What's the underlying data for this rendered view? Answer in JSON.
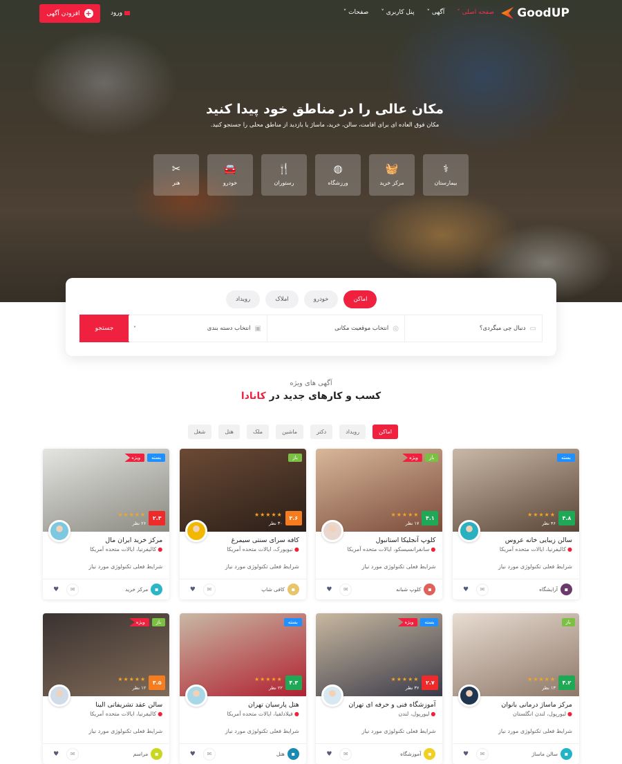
{
  "header": {
    "logo": "GoodUP",
    "menu": [
      {
        "label": "صفحه اصلی",
        "active": true
      },
      {
        "label": "آگهی"
      },
      {
        "label": "پنل کاربری"
      },
      {
        "label": "صفحات"
      }
    ],
    "login": "ورود",
    "add_listing": "افزودن آگهی"
  },
  "hero": {
    "title": "مکان عالی را در مناطق خود پیدا کنید",
    "subtitle": "مکان فوق العاده ای برای اقامت، سالن، خرید، ماساژ یا بازدید از مناطق محلی را جستجو کنید.",
    "categories": [
      {
        "label": "بیمارستان",
        "icon": "stethoscope-icon",
        "glyph": "⚕"
      },
      {
        "label": "مرکز خرید",
        "icon": "basket-icon",
        "glyph": "🧺"
      },
      {
        "label": "ورزشگاه",
        "icon": "basketball-icon",
        "glyph": "◍"
      },
      {
        "label": "رستوران",
        "icon": "utensils-icon",
        "glyph": "🍴"
      },
      {
        "label": "خودرو",
        "icon": "car-icon",
        "glyph": "🚘"
      },
      {
        "label": "هنر",
        "icon": "tools-icon",
        "glyph": "✂"
      }
    ]
  },
  "search": {
    "tabs": [
      {
        "label": "اماکن",
        "active": true
      },
      {
        "label": "خودرو"
      },
      {
        "label": "املاک"
      },
      {
        "label": "رویداد"
      }
    ],
    "keyword_placeholder": "دنبال چی میگردی؟",
    "location_placeholder": "انتخاب موقعیت مکانی",
    "category_placeholder": "انتخاب دسته بندی",
    "button": "جستجو"
  },
  "section": {
    "subtitle": "آگهی های ویژه",
    "title": "کسب و کارهای جدید در",
    "title_highlight": "کانادا",
    "filters": [
      {
        "label": "اماکن",
        "active": true
      },
      {
        "label": "رویداد"
      },
      {
        "label": "دکتر"
      },
      {
        "label": "ماشین"
      },
      {
        "label": "ملک"
      },
      {
        "label": "هتل"
      },
      {
        "label": "شغل"
      }
    ]
  },
  "colors": {
    "accent": "#f0213f",
    "open": "#7bc043",
    "closed": "#1e90ff",
    "rating_high": "#1fa855",
    "rating_mid": "#f57c1f",
    "rating_low": "#ee2a2a"
  },
  "cards": [
    {
      "title": "سالن زیبایی خانه عروس",
      "location": "کالیفرنیا، ایالات متحده آمریکا",
      "rating": "۴.۸",
      "rating_color": "#1fa855",
      "reviews": "۴۶ نظر",
      "stars": 5,
      "badges": [
        {
          "label": "بسته",
          "type": "closed"
        }
      ],
      "desc": "شرایط فعلی تکنولوژی مورد نیاز",
      "category": "آرایشگاه",
      "cat_color": "#6b3a6b",
      "img": [
        "#c9b8a8",
        "#5a4536"
      ],
      "avatar": "#2bb0c0"
    },
    {
      "title": "کلوپ آنجلیکا استانبول",
      "location": "سانفرانسیسکو، ایالات متحده آمریکا",
      "rating": "۴.۱",
      "rating_color": "#1fa855",
      "reviews": "۱۷ نظر",
      "stars": 5,
      "badges": [
        {
          "label": "باز",
          "type": "open"
        },
        {
          "label": "ویژه",
          "type": "feat"
        }
      ],
      "desc": "شرایط فعلی تکنولوژی مورد نیاز",
      "category": "کلوپ شبانه",
      "cat_color": "#e0605a",
      "img": [
        "#d8b79a",
        "#7a4b3a"
      ],
      "avatar": "#e8d8d0"
    },
    {
      "title": "کافه سرای سنتی سیمرغ",
      "location": "نیویورک، ایالات متحده آمریکا",
      "rating": "۳.۶",
      "rating_color": "#f57c1f",
      "reviews": "۳۰ نظر",
      "stars": 5,
      "badges": [
        {
          "label": "باز",
          "type": "open"
        }
      ],
      "desc": "شرایط فعلی تکنولوژی مورد نیاز",
      "category": "کافی شاپ",
      "cat_color": "#e8c46a",
      "img": [
        "#6b4a35",
        "#2a1e18"
      ],
      "avatar": "#f2b800"
    },
    {
      "title": "مرکز خرید ایران مال",
      "location": "کالیفرنیا، ایالات متحده آمریکا",
      "rating": "۲.۳",
      "rating_color": "#ee2a2a",
      "reviews": "۲۶ نظر",
      "stars": 5,
      "badges": [
        {
          "label": "بسته",
          "type": "closed"
        },
        {
          "label": "ویژه",
          "type": "feat"
        }
      ],
      "desc": "شرایط فعلی تکنولوژی مورد نیاز",
      "category": "مرکز خرید",
      "cat_color": "#2bb5c8",
      "img": [
        "#e4e4e2",
        "#8a8a80"
      ],
      "avatar": "#7bc8e0"
    },
    {
      "title": "مرکز ماساژ درمانی بانوان",
      "location": "لیورپول، لندن انگلستان",
      "rating": "۴.۲",
      "rating_color": "#1fa855",
      "reviews": "۱۳ نظر",
      "stars": 5,
      "badges": [
        {
          "label": "باز",
          "type": "open"
        }
      ],
      "desc": "شرایط فعلی تکنولوژی مورد نیاز",
      "category": "سالن ماساژ",
      "cat_color": "#22b3c6",
      "img": [
        "#e8dcd2",
        "#8e7868"
      ],
      "avatar": "#1f3550"
    },
    {
      "title": "آموزشگاه فنی و حرفه ای تهران",
      "location": "لیورپول، لندن",
      "rating": "۲.۷",
      "rating_color": "#ee2a2a",
      "reviews": "۳۶ نظر",
      "stars": 5,
      "badges": [
        {
          "label": "بسته",
          "type": "closed"
        },
        {
          "label": "ویژه",
          "type": "feat"
        }
      ],
      "desc": "شرایط فعلی تکنولوژی مورد نیاز",
      "category": "آموزشگاه",
      "cat_color": "#f0d020",
      "img": [
        "#c8b8a0",
        "#3a3a48"
      ],
      "avatar": "#d8e8f0"
    },
    {
      "title": "هتل پارسیان تهران",
      "location": "فیلادلفیا، ایالات متحده آمریکا",
      "rating": "۴.۳",
      "rating_color": "#1fa855",
      "reviews": "۲۲ نظر",
      "stars": 5,
      "badges": [
        {
          "label": "بسته",
          "type": "closed"
        }
      ],
      "desc": "شرایط فعلی تکنولوژی مورد نیاز",
      "category": "هتل",
      "cat_color": "#1a8bb0",
      "img": [
        "#c8b8a4",
        "#b02030"
      ],
      "avatar": "#a8d8e8"
    },
    {
      "title": "سالن عقد تشریفاتی الینا",
      "location": "کالیفرنیا، ایالات متحده آمریکا",
      "rating": "۳.۵",
      "rating_color": "#f57c1f",
      "reviews": "۱۲ نظر",
      "stars": 5,
      "badges": [
        {
          "label": "باز",
          "type": "open"
        },
        {
          "label": "ویژه",
          "type": "feat"
        }
      ],
      "desc": "شرایط فعلی تکنولوژی مورد نیاز",
      "category": "مراسم",
      "cat_color": "#c8d820",
      "img": [
        "#3a3230",
        "#806a58"
      ],
      "avatar": "#d0dce8"
    }
  ]
}
